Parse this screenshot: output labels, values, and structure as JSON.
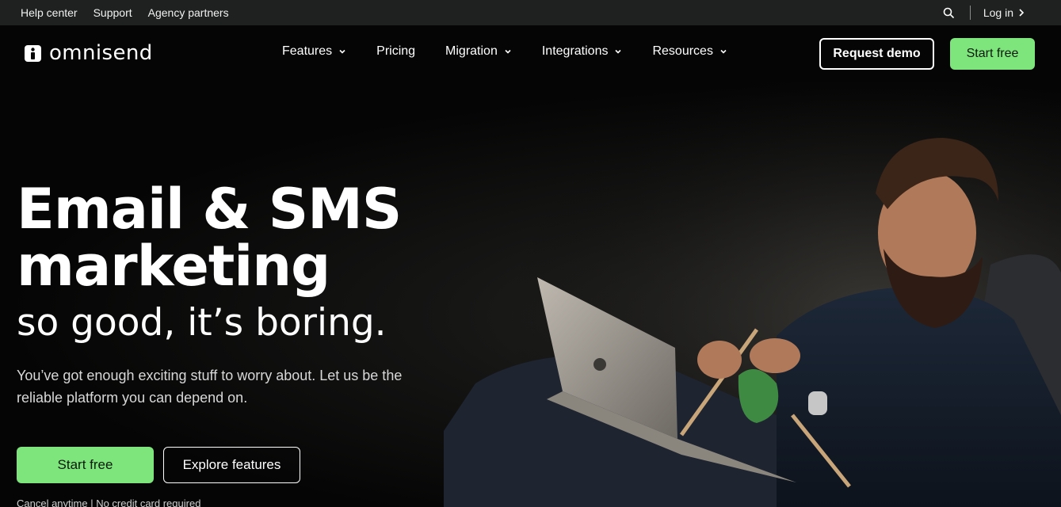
{
  "topbar": {
    "links": [
      "Help center",
      "Support",
      "Agency partners"
    ],
    "login_label": "Log in"
  },
  "nav": {
    "logo_text": "omnisend",
    "menu": [
      {
        "label": "Features",
        "dropdown": true
      },
      {
        "label": "Pricing",
        "dropdown": false
      },
      {
        "label": "Migration",
        "dropdown": true
      },
      {
        "label": "Integrations",
        "dropdown": true
      },
      {
        "label": "Resources",
        "dropdown": true
      }
    ],
    "request_demo": "Request demo",
    "start_free": "Start free"
  },
  "hero": {
    "headline_line1": "Email & SMS",
    "headline_line2": "marketing",
    "subheadline": "so good, it’s boring.",
    "lead": "You’ve got enough exciting stuff to worry about. Let us be the reliable platform you can depend on.",
    "cta_primary": "Start free",
    "cta_secondary": "Explore features",
    "fineprint": "Cancel anytime | No credit card required"
  },
  "colors": {
    "accent_green": "#7ee57d",
    "topbar_bg": "#1f2121",
    "nav_bg": "#050505"
  },
  "icons": {
    "search": "search-icon",
    "login_arrow": "chevron-right-icon",
    "dropdown": "chevron-down-icon",
    "logo": "omnisend-logo-icon"
  }
}
